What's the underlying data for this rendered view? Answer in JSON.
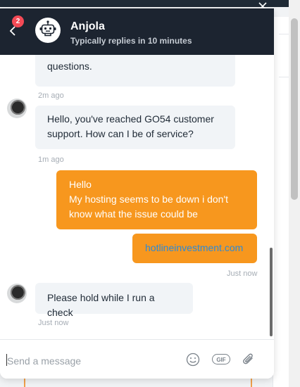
{
  "header": {
    "badge_count": "2",
    "agent_name": "Anjola",
    "status": "Typically replies in 10 minutes"
  },
  "messages": [
    {
      "from": "agent",
      "text": "questions.",
      "time": "2m ago"
    },
    {
      "from": "agent",
      "text": "Hello, you've reached GO54 customer support. How can I be of service?",
      "time": "1m ago"
    },
    {
      "from": "user",
      "lines": [
        "Hello",
        "My hosting seems to be down i don't know what the issue could be"
      ]
    },
    {
      "from": "user",
      "text": "hotlineinvestment.com",
      "time": "Just now"
    },
    {
      "from": "agent",
      "text": "Please hold while I run a check",
      "time": "Just now"
    }
  ],
  "composer": {
    "placeholder": "Send a message"
  },
  "icons": {
    "back": "chevron-left-icon",
    "bot": "robot-icon",
    "close": "close-icon",
    "emoji": "emoji-icon",
    "gif": "gif-icon",
    "attach": "paperclip-icon",
    "gif_label": "GIF"
  },
  "colors": {
    "header_bg": "#1c2430",
    "user_bubble": "#f7971e",
    "agent_bubble": "#f1f4f7",
    "badge": "#f44a56",
    "link": "#2b8ad8"
  }
}
